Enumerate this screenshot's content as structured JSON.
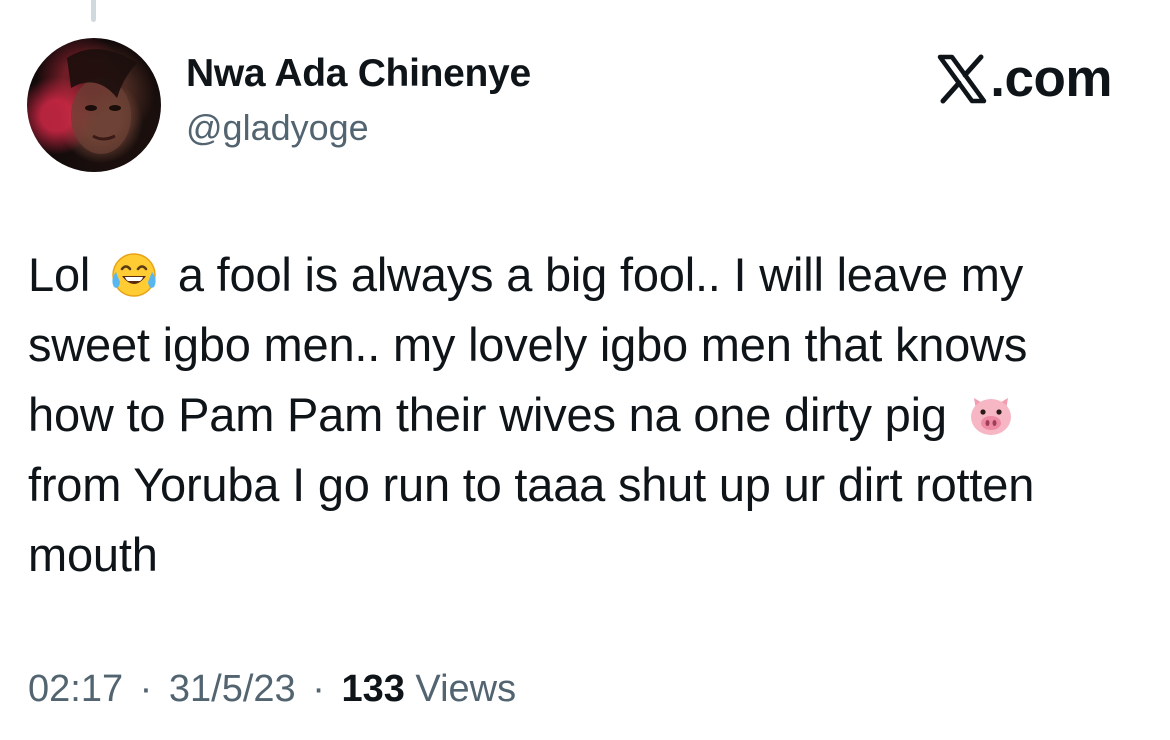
{
  "tweet": {
    "author": {
      "display_name": "Nwa Ada Chinenye",
      "handle": "@gladyoge"
    },
    "source": {
      "label": ".com",
      "logo_icon": "x-logo-icon"
    },
    "body": {
      "line1_a": "Lol",
      "line1_emoji": "face-with-tears-of-joy-icon",
      "line1_b": "a fool is always a big fool.. I will leave my",
      "line2": "sweet igbo men.. my lovely igbo men that knows",
      "line3_a": "how to Pam Pam their wives na one dirty pig",
      "line3_emoji": "pig-face-icon",
      "line4": "from Yoruba I go run to taaa shut up ur dirt rotten",
      "line5": "mouth"
    },
    "meta": {
      "time": "02:17",
      "date": "31/5/23",
      "views_count": "133",
      "views_label": "Views",
      "separator": "·"
    }
  },
  "colors": {
    "text_primary": "#0f1419",
    "text_secondary": "#536471",
    "thread_line": "#cfd9de"
  }
}
